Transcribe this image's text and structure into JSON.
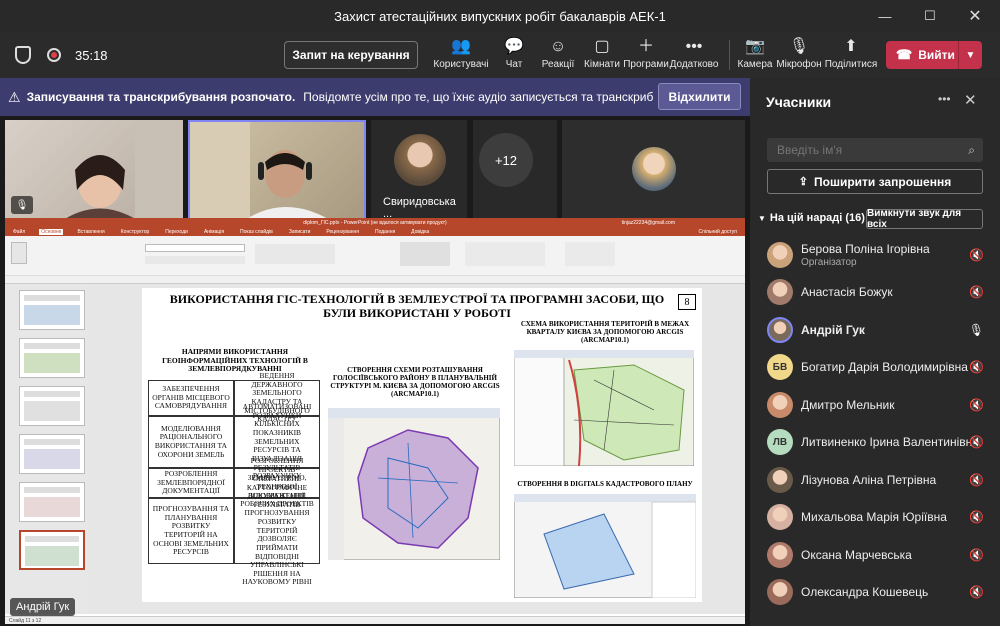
{
  "window": {
    "title": "Захист атестаційних випускних робіт бакалаврів АЕК-1"
  },
  "toolbar": {
    "timer": "35:18",
    "request_control": "Запит на керування",
    "items": [
      {
        "label": "Користувачі",
        "icon": "people-icon"
      },
      {
        "label": "Чат",
        "icon": "chat-icon"
      },
      {
        "label": "Реакції",
        "icon": "reactions-icon"
      },
      {
        "label": "Кімнати",
        "icon": "rooms-icon"
      },
      {
        "label": "Програми",
        "icon": "apps-icon"
      },
      {
        "label": "Додатково",
        "icon": "more-icon"
      },
      {
        "label": "Камера",
        "icon": "camera-off-icon"
      },
      {
        "label": "Мікрофон",
        "icon": "mic-off-icon"
      },
      {
        "label": "Поділитися",
        "icon": "share-icon"
      }
    ],
    "leave": "Вийти"
  },
  "banner": {
    "bold": "Записування та транскрибування розпочато.",
    "text": "Повідомте усім про те, що їхнє аудіо записується та транскрибується. П...",
    "dismiss": "Відхилити"
  },
  "video": {
    "tile3_name": "Свиридовська ...",
    "overflow": "+12",
    "presenter_label": "Андрій Гук"
  },
  "ppt": {
    "titlebar": "diplom_ГІС.pptx - PowerPoint (не вдалося активувати продукт)",
    "user": "tinjaz22234@gmail.com",
    "tabs": [
      "Файл",
      "Основне",
      "Вставлення",
      "Конструктор",
      "Переходи",
      "Анімація",
      "Показ слайдів",
      "Записати",
      "Рецензування",
      "Подання",
      "Довідка"
    ],
    "share": "Спільний доступ",
    "slide_title": "ВИКОРИСТАННЯ ГІС-ТЕХНОЛОГІЙ В ЗЕМЛЕУСТРОЇ ТА ПРОГРАМНІ ЗАСОБИ, ЩО БУЛИ ВИКОРИСТАНІ У РОБОТІ",
    "slide_no": "8",
    "table_title": "НАПРЯМИ ВИКОРИСТАННЯ ГЕОІНФОРМАЦІЙНИХ ТЕХНОЛОГІЙ В ЗЕМЛЕВПОРЯДКУВАННІ",
    "table": [
      [
        "ЗАБЕЗПЕЧЕННЯ ОРГАНІВ МІСЦЕВОГО САМОВРЯДУВАННЯ",
        "ВЕДЕННЯ ДЕРЖАВНОГО ЗЕМЕЛЬНОГО КАДАСТРУ ТА МІСТОБУДІВНОГО КАДАСТРУ"
      ],
      [
        "МОДЕЛЮВАННЯ РАЦІОНАЛЬНОГО ВИКОРИСТАННЯ ТА ОХОРОНИ ЗЕМЕЛЬ",
        "АВТОМАТИЗОВАНІ РОЗРАХУНКИ КІЛЬКІСНИХ ПОКАЗНИКІВ ЗЕМЕЛЬНИХ РЕСУРСІВ ТА ВІЗУАЛІЗАЦІЯ РЕЗУЛЬТАТІВ РОЗРАХУНКУ"
      ],
      [
        "РОЗРОБЛЕННЯ ЗЕМЛЕВПОРЯДНОЇ ДОКУМЕНТАЦІЇ",
        "РОЗРОБЛЕННЯ ПРОЕКТІВ ЗЕМЛЕУСТРОЮ, ТЕХНІЧНОЇ ДОКУМЕНТАЦІЇ, РОБОЧИХ ПРОЕКТІВ"
      ],
      [
        "ПРОГНОЗУВАННЯ ТА ПЛАНУВАННЯ РОЗВИТКУ ТЕРИТОРІЙ НА ОСНОВІ ЗЕМЕЛЬНИХ РЕСУРСІВ",
        "ОПЕРАТИВНЕ КАРТОГРАФІЧНЕ ВІДОБРАЖЕННЯ РЕЗУЛЬТАТІВ ПРОГНОЗУВАННЯ РОЗВИТКУ ТЕРИТОРІЙ ДОЗВОЛЯЄ ПРИЙМАТИ ВІДПОВІДНІ УПРАВЛІНСЬКІ РІШЕННЯ НА НАУКОВОМУ РІВНІ"
      ]
    ],
    "mid_title": "СТВОРЕННЯ СХЕМИ РОЗТАШУВАННЯ ГОЛОСІЇВСЬКОГО РАЙОНУ В ПЛАНУВАЛЬНІЙ СТРУКТУРІ М. КИЄВА ЗА ДОПОМОГОЮ ARCGIS (ARCMAP10.1)",
    "right_title": "СХЕМА ВИКОРИСТАННЯ ТЕРИТОРІЙ В МЕЖАХ КВАРТАЛУ КИЄВА ЗА ДОПОМОГОЮ ARCGIS (ARCMAP10.1)",
    "right_bottom_title": "СТВОРЕННЯ В DIGITALS КАДАСТРОВОГО ПЛАНУ",
    "status": "Слайд 11 з 12"
  },
  "panel": {
    "title": "Учасники",
    "search_placeholder": "Введіть ім'я",
    "invite": "Поширити запрошення",
    "section": "На цій нараді (16)",
    "mute_all": "Вимкнути звук для всіх",
    "participants": [
      {
        "name": "Берова Поліна Ігорівна",
        "sub": "Організатор",
        "initials": "",
        "color": "#c9a27a",
        "mic": "off"
      },
      {
        "name": "Анастасія Божук",
        "sub": "",
        "initials": "",
        "color": "#a07a6a",
        "mic": "off"
      },
      {
        "name": "Андрій Гук",
        "sub": "",
        "initials": "",
        "color": "#7a6a5a",
        "mic": "on"
      },
      {
        "name": "Богатир Дарія Володимирівна",
        "sub": "",
        "initials": "БВ",
        "color": "#f0d78a",
        "mic": "off"
      },
      {
        "name": "Дмитро Мельник",
        "sub": "",
        "initials": "",
        "color": "#c98a6a",
        "mic": "off"
      },
      {
        "name": "Литвиненко Ірина Валентинівна",
        "sub": "",
        "initials": "ЛВ",
        "color": "#b6dcc0",
        "mic": "off"
      },
      {
        "name": "Лізунова Аліна Петрівна",
        "sub": "",
        "initials": "",
        "color": "#6a5a4a",
        "mic": "off"
      },
      {
        "name": "Михальова Марія Юріївна",
        "sub": "",
        "initials": "",
        "color": "#d6b0a0",
        "mic": "off"
      },
      {
        "name": "Оксана Марчевська",
        "sub": "",
        "initials": "",
        "color": "#b07a6a",
        "mic": "off"
      },
      {
        "name": "Олександра Кошевець",
        "sub": "",
        "initials": "",
        "color": "#9a6a5a",
        "mic": "off"
      }
    ]
  }
}
